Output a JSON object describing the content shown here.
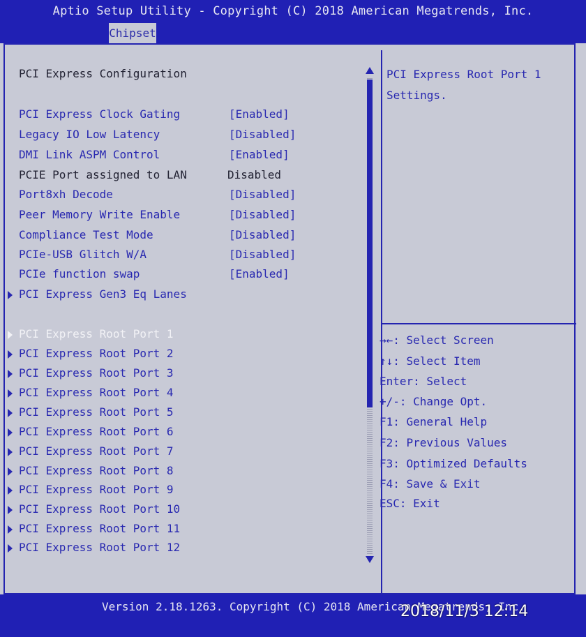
{
  "header": {
    "title": "Aptio Setup Utility - Copyright (C) 2018 American Megatrends, Inc.",
    "tabs": [
      {
        "label": "Chipset",
        "active": true
      }
    ]
  },
  "main": {
    "section_title": "PCI Express Configuration",
    "settings": [
      {
        "label": "PCI Express Clock Gating",
        "value": "[Enabled]"
      },
      {
        "label": "Legacy IO Low Latency",
        "value": "[Disabled]"
      },
      {
        "label": "DMI Link ASPM Control",
        "value": "[Enabled]"
      },
      {
        "label": "PCIE Port assigned to LAN",
        "value": "Disabled"
      },
      {
        "label": "Port8xh Decode",
        "value": "[Disabled]"
      },
      {
        "label": "Peer Memory Write Enable",
        "value": "[Disabled]"
      },
      {
        "label": "Compliance Test Mode",
        "value": "[Disabled]"
      },
      {
        "label": "PCIe-USB Glitch W/A",
        "value": "[Disabled]"
      },
      {
        "label": "PCIe function swap",
        "value": "[Enabled]"
      }
    ],
    "submenu_gen3": "PCI Express Gen3 Eq Lanes",
    "root_ports": [
      "PCI Express Root Port 1",
      "PCI Express Root Port 2",
      "PCI Express Root Port 3",
      "PCI Express Root Port 4",
      "PCI Express Root Port 5",
      "PCI Express Root Port 6",
      "PCI Express Root Port 7",
      "PCI Express Root Port 8",
      "PCI Express Root Port 9",
      "PCI Express Root Port 10",
      "PCI Express Root Port 11",
      "PCI Express Root Port 12"
    ],
    "selected": "PCI Express Root Port 1"
  },
  "help": {
    "line1": "PCI Express Root Port 1",
    "line2": "Settings.",
    "keys": [
      "→←: Select Screen",
      "↑↓: Select Item",
      "Enter: Select",
      "+/-: Change Opt.",
      "F1: General Help",
      "F2: Previous Values",
      "F3: Optimized Defaults",
      "F4: Save & Exit",
      "ESC: Exit"
    ]
  },
  "footer": {
    "version": "Version 2.18.1263. Copyright (C) 2018 American Megatrends, Inc."
  },
  "photo_stamp": "2018/11/3  12:14",
  "colors": {
    "background": "#c8cad6",
    "accent_blue": "#2020b4",
    "text_blue": "#2828b0",
    "text_dark": "#222233",
    "selected_text": "#f2f2f6"
  }
}
